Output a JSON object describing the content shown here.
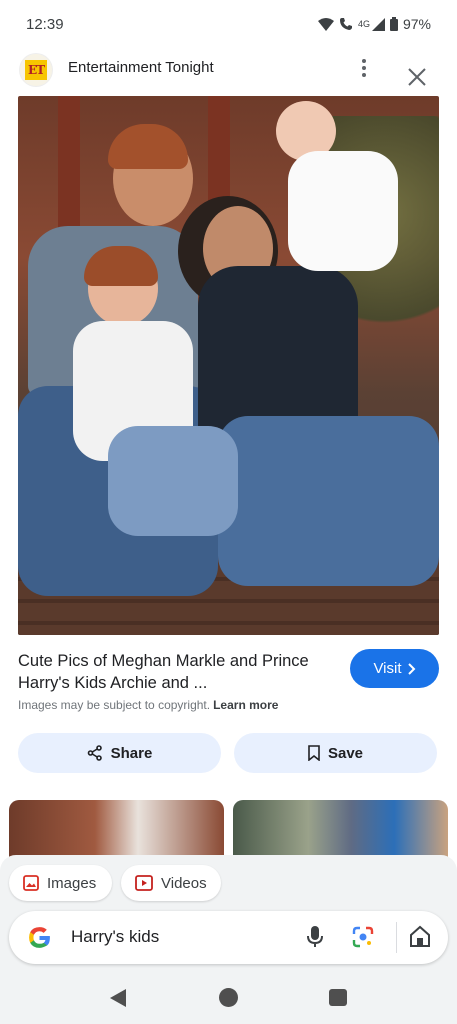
{
  "status_bar": {
    "time": "12:39",
    "network": "4G",
    "battery": "97%",
    "icons": [
      "wifi-icon",
      "call-icon",
      "signal-icon",
      "battery-icon"
    ]
  },
  "source": {
    "logo_text": "ET",
    "name": "Entertainment Tonight"
  },
  "result": {
    "title": "Cute Pics of Meghan Markle and Prince Harry's Kids Archie and ...",
    "visit_label": "Visit",
    "copyright_text": "Images may be subject to copyright.",
    "learn_more": "Learn more",
    "share_label": "Share",
    "save_label": "Save"
  },
  "chips": {
    "images_label": "Images",
    "videos_label": "Videos"
  },
  "search": {
    "query": "Harry's kids"
  },
  "colors": {
    "accent": "#1a73e8",
    "pill_bg": "#e8f0fe",
    "panel_bg": "#f1f3f4"
  }
}
